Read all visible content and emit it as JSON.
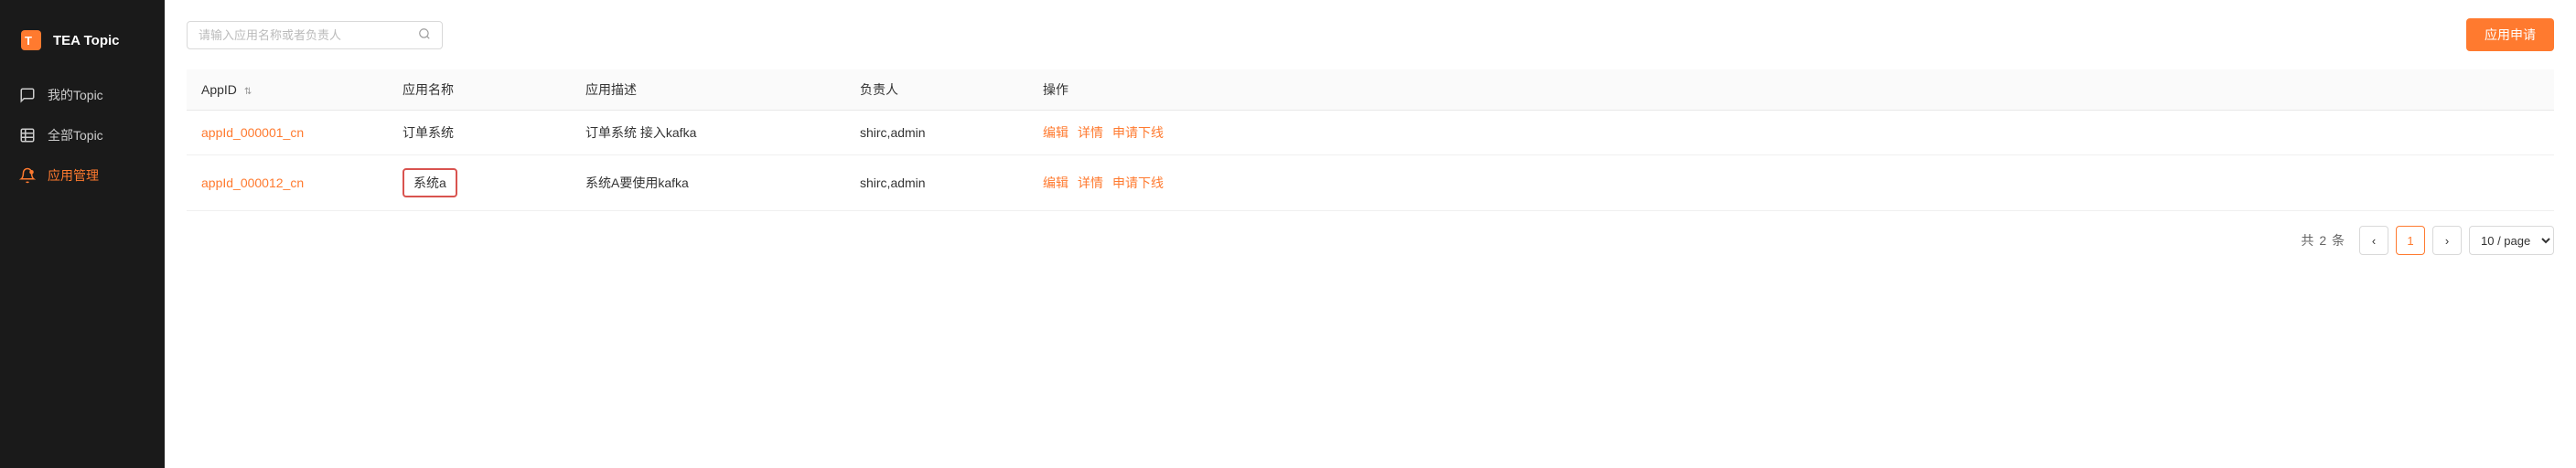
{
  "sidebar": {
    "logo": {
      "text": "TEA Topic"
    },
    "items": [
      {
        "id": "my-topic",
        "label": "我的Topic",
        "icon": "💬",
        "active": false
      },
      {
        "id": "all-topic",
        "label": "全部Topic",
        "icon": "📋",
        "active": false
      },
      {
        "id": "app-management",
        "label": "应用管理",
        "icon": "🔔",
        "active": true
      }
    ]
  },
  "toolbar": {
    "search_placeholder": "请输入应用名称或者负责人",
    "apply_button_label": "应用申请"
  },
  "table": {
    "columns": [
      {
        "id": "appid",
        "label": "AppID",
        "sortable": true
      },
      {
        "id": "app_name",
        "label": "应用名称",
        "sortable": false
      },
      {
        "id": "app_desc",
        "label": "应用描述",
        "sortable": false
      },
      {
        "id": "owner",
        "label": "负责人",
        "sortable": false
      },
      {
        "id": "actions",
        "label": "操作",
        "sortable": false
      }
    ],
    "rows": [
      {
        "appid": "appId_000001_cn",
        "app_name": "订单系统",
        "app_desc": "订单系统 接入kafka",
        "owner": "shirc,admin",
        "highlighted": false,
        "actions": [
          "编辑",
          "详情",
          "申请下线"
        ]
      },
      {
        "appid": "appId_000012_cn",
        "app_name": "系统a",
        "app_desc": "系统A要使用kafka",
        "owner": "shirc,admin",
        "highlighted": true,
        "actions": [
          "编辑",
          "详情",
          "申请下线"
        ]
      }
    ]
  },
  "pagination": {
    "total_prefix": "共",
    "total_count": "2",
    "total_suffix": "条",
    "current_page": 1,
    "page_size": 10,
    "page_size_label": "10 / page"
  }
}
